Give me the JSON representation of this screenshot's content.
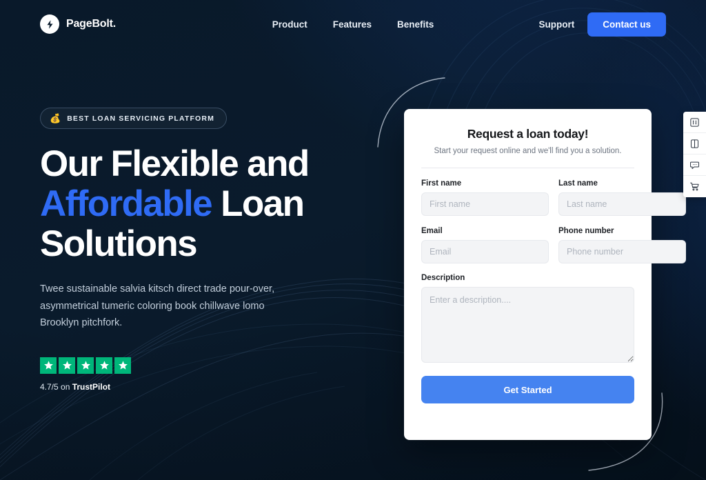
{
  "brand": {
    "name": "PageBolt.",
    "logo_icon": "lightning-bolt-icon"
  },
  "nav": {
    "items": [
      {
        "label": "Product"
      },
      {
        "label": "Features"
      },
      {
        "label": "Benefits"
      }
    ],
    "support_label": "Support",
    "contact_label": "Contact us"
  },
  "hero": {
    "badge_emoji": "💰",
    "badge_text": "BEST LOAN SERVICING PLATFORM",
    "headline_line1": "Our Flexible and",
    "headline_accent": "Affordable",
    "headline_line2_rest": " Loan",
    "headline_line3": "Solutions",
    "paragraph": "Twee sustainable salvia kitsch direct trade pour-over, asymmetrical tumeric coloring book chillwave lomo Brooklyn pitchfork.",
    "rating": {
      "stars": 5,
      "score_prefix": "4.7/5 on ",
      "provider": "TrustPilot",
      "star_color": "#00b67a"
    }
  },
  "form": {
    "title": "Request a loan today!",
    "subtitle": "Start your request online and we'll find you a solution.",
    "fields": [
      {
        "label": "First name",
        "placeholder": "First name",
        "value": "",
        "name": "first-name"
      },
      {
        "label": "Last name",
        "placeholder": "Last name",
        "value": "",
        "name": "last-name"
      },
      {
        "label": "Email",
        "placeholder": "Email",
        "value": "",
        "name": "email"
      },
      {
        "label": "Phone number",
        "placeholder": "Phone number",
        "value": "",
        "name": "phone-number"
      }
    ],
    "description": {
      "label": "Description",
      "placeholder": "Enter a description....",
      "value": ""
    },
    "submit_label": "Get Started"
  },
  "side_toolbar": {
    "items": [
      {
        "icon": "sliders-settings-icon"
      },
      {
        "icon": "book-layout-icon"
      },
      {
        "icon": "chat-bubble-icon"
      },
      {
        "icon": "shopping-cart-icon"
      }
    ]
  },
  "colors": {
    "background": "#0a1a2b",
    "accent_blue": "#2f6bf5",
    "button_blue": "#4583f0",
    "trustpilot_green": "#00b67a",
    "card_background": "#ffffff",
    "input_background": "#f3f4f6"
  }
}
